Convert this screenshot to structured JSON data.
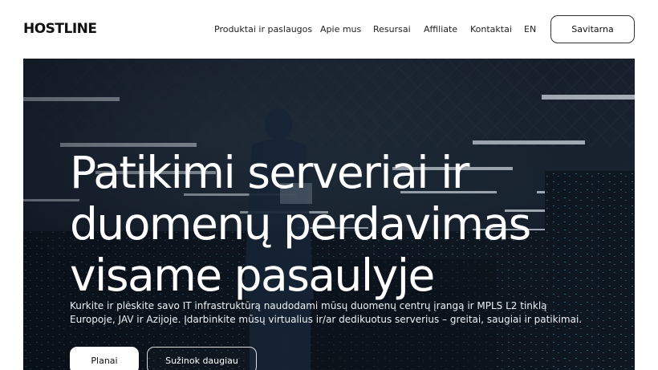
{
  "header": {
    "logo": "HOSTLINE",
    "nav": [
      {
        "label": "Produktai ir paslaugos"
      },
      {
        "label": "Apie mus"
      },
      {
        "label": "Resursai"
      },
      {
        "label": "Affiliate"
      },
      {
        "label": "Kontaktai"
      },
      {
        "label": "EN"
      }
    ],
    "cta": "Savitarna"
  },
  "hero": {
    "title_lines": [
      "Patikimi serveriai ir",
      "duomenų perdavimas",
      "visame pasaulyje"
    ],
    "description_lines": [
      "Kurkite ir plėskite savo IT infrastruktūrą naudodami mūsų duomenų centrų įrangą ir MPLS L2 tinklą",
      "Europoje, JAV ir Azijoje. Įdarbinkite mūsų virtualius ir/ar dedikuotus serverius – greitai, saugiai ir patikimai."
    ],
    "primary_button": "Planai",
    "secondary_button": "Sužinok daugiau"
  }
}
